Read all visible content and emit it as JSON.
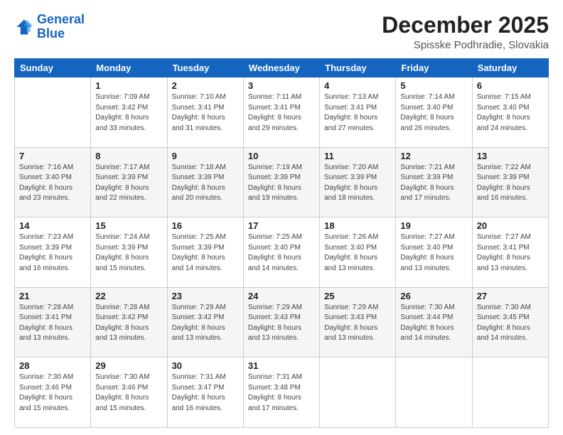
{
  "header": {
    "logo_line1": "General",
    "logo_line2": "Blue",
    "month": "December 2025",
    "location": "Spisske Podhradie, Slovakia"
  },
  "weekdays": [
    "Sunday",
    "Monday",
    "Tuesday",
    "Wednesday",
    "Thursday",
    "Friday",
    "Saturday"
  ],
  "weeks": [
    [
      {
        "day": "",
        "info": ""
      },
      {
        "day": "1",
        "info": "Sunrise: 7:09 AM\nSunset: 3:42 PM\nDaylight: 8 hours\nand 33 minutes."
      },
      {
        "day": "2",
        "info": "Sunrise: 7:10 AM\nSunset: 3:41 PM\nDaylight: 8 hours\nand 31 minutes."
      },
      {
        "day": "3",
        "info": "Sunrise: 7:11 AM\nSunset: 3:41 PM\nDaylight: 8 hours\nand 29 minutes."
      },
      {
        "day": "4",
        "info": "Sunrise: 7:13 AM\nSunset: 3:41 PM\nDaylight: 8 hours\nand 27 minutes."
      },
      {
        "day": "5",
        "info": "Sunrise: 7:14 AM\nSunset: 3:40 PM\nDaylight: 8 hours\nand 26 minutes."
      },
      {
        "day": "6",
        "info": "Sunrise: 7:15 AM\nSunset: 3:40 PM\nDaylight: 8 hours\nand 24 minutes."
      }
    ],
    [
      {
        "day": "7",
        "info": "Sunrise: 7:16 AM\nSunset: 3:40 PM\nDaylight: 8 hours\nand 23 minutes."
      },
      {
        "day": "8",
        "info": "Sunrise: 7:17 AM\nSunset: 3:39 PM\nDaylight: 8 hours\nand 22 minutes."
      },
      {
        "day": "9",
        "info": "Sunrise: 7:18 AM\nSunset: 3:39 PM\nDaylight: 8 hours\nand 20 minutes."
      },
      {
        "day": "10",
        "info": "Sunrise: 7:19 AM\nSunset: 3:39 PM\nDaylight: 8 hours\nand 19 minutes."
      },
      {
        "day": "11",
        "info": "Sunrise: 7:20 AM\nSunset: 3:39 PM\nDaylight: 8 hours\nand 18 minutes."
      },
      {
        "day": "12",
        "info": "Sunrise: 7:21 AM\nSunset: 3:39 PM\nDaylight: 8 hours\nand 17 minutes."
      },
      {
        "day": "13",
        "info": "Sunrise: 7:22 AM\nSunset: 3:39 PM\nDaylight: 8 hours\nand 16 minutes."
      }
    ],
    [
      {
        "day": "14",
        "info": "Sunrise: 7:23 AM\nSunset: 3:39 PM\nDaylight: 8 hours\nand 16 minutes."
      },
      {
        "day": "15",
        "info": "Sunrise: 7:24 AM\nSunset: 3:39 PM\nDaylight: 8 hours\nand 15 minutes."
      },
      {
        "day": "16",
        "info": "Sunrise: 7:25 AM\nSunset: 3:39 PM\nDaylight: 8 hours\nand 14 minutes."
      },
      {
        "day": "17",
        "info": "Sunrise: 7:25 AM\nSunset: 3:40 PM\nDaylight: 8 hours\nand 14 minutes."
      },
      {
        "day": "18",
        "info": "Sunrise: 7:26 AM\nSunset: 3:40 PM\nDaylight: 8 hours\nand 13 minutes."
      },
      {
        "day": "19",
        "info": "Sunrise: 7:27 AM\nSunset: 3:40 PM\nDaylight: 8 hours\nand 13 minutes."
      },
      {
        "day": "20",
        "info": "Sunrise: 7:27 AM\nSunset: 3:41 PM\nDaylight: 8 hours\nand 13 minutes."
      }
    ],
    [
      {
        "day": "21",
        "info": "Sunrise: 7:28 AM\nSunset: 3:41 PM\nDaylight: 8 hours\nand 13 minutes."
      },
      {
        "day": "22",
        "info": "Sunrise: 7:28 AM\nSunset: 3:42 PM\nDaylight: 8 hours\nand 13 minutes."
      },
      {
        "day": "23",
        "info": "Sunrise: 7:29 AM\nSunset: 3:42 PM\nDaylight: 8 hours\nand 13 minutes."
      },
      {
        "day": "24",
        "info": "Sunrise: 7:29 AM\nSunset: 3:43 PM\nDaylight: 8 hours\nand 13 minutes."
      },
      {
        "day": "25",
        "info": "Sunrise: 7:29 AM\nSunset: 3:43 PM\nDaylight: 8 hours\nand 13 minutes."
      },
      {
        "day": "26",
        "info": "Sunrise: 7:30 AM\nSunset: 3:44 PM\nDaylight: 8 hours\nand 14 minutes."
      },
      {
        "day": "27",
        "info": "Sunrise: 7:30 AM\nSunset: 3:45 PM\nDaylight: 8 hours\nand 14 minutes."
      }
    ],
    [
      {
        "day": "28",
        "info": "Sunrise: 7:30 AM\nSunset: 3:46 PM\nDaylight: 8 hours\nand 15 minutes."
      },
      {
        "day": "29",
        "info": "Sunrise: 7:30 AM\nSunset: 3:46 PM\nDaylight: 8 hours\nand 15 minutes."
      },
      {
        "day": "30",
        "info": "Sunrise: 7:31 AM\nSunset: 3:47 PM\nDaylight: 8 hours\nand 16 minutes."
      },
      {
        "day": "31",
        "info": "Sunrise: 7:31 AM\nSunset: 3:48 PM\nDaylight: 8 hours\nand 17 minutes."
      },
      {
        "day": "",
        "info": ""
      },
      {
        "day": "",
        "info": ""
      },
      {
        "day": "",
        "info": ""
      }
    ]
  ]
}
